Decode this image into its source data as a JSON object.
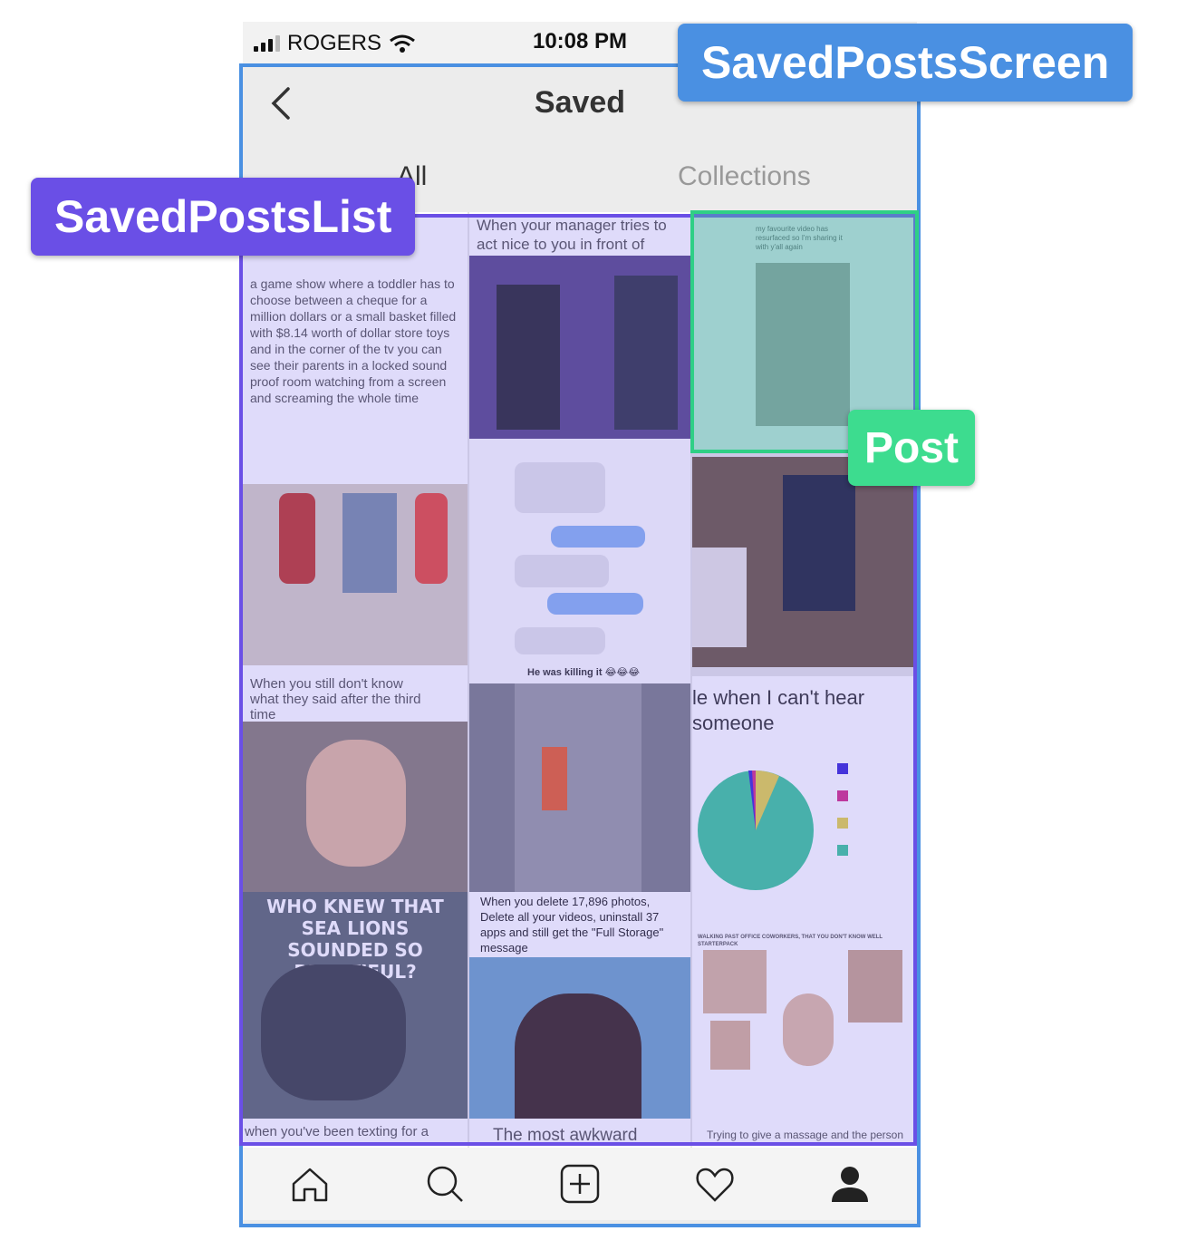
{
  "status": {
    "carrier": "ROGERS",
    "time": "10:08 PM"
  },
  "nav": {
    "title": "Saved"
  },
  "tabs": [
    {
      "label": "All"
    },
    {
      "label": "Collections"
    }
  ],
  "posts": [
    {
      "caption": "a game show where a toddler has to choose between a cheque for a million dollars or a small basket filled with $8.14 worth of dollar store toys and in the corner of the tv you can see their parents in a locked sound proof room watching from a screen and screaming the whole time"
    },
    {
      "caption": "When your manager tries to act nice to you in front of customers"
    },
    {
      "caption": "my favourite video has resurfaced so I'm sharing it with y'all again"
    },
    {
      "caption": "He was killing it 😂😂😂"
    },
    {
      "caption": "When you still don't know what they said after the third time"
    },
    {
      "caption": "le when I can't hear someone"
    },
    {
      "caption": "WHO KNEW THAT SEA LIONS SOUNDED SO BEAUTIFUL?"
    },
    {
      "caption": "When you delete 17,896 photos, Delete all your videos, uninstall 37 apps and still get the \"Full Storage\" message"
    },
    {
      "caption": "WALKING PAST OFFICE COWORKERS, THAT YOU DON'T KNOW WELL STARTERPACK"
    },
    {
      "caption": "when you've been texting for a"
    },
    {
      "caption": "The most awkward"
    },
    {
      "caption": "Trying to give a massage and the person"
    }
  ],
  "annotations": {
    "screen": "SavedPostsScreen",
    "list": "SavedPostsList",
    "post": "Post"
  },
  "colors": {
    "screen": "#4a90e2",
    "list": "#6a4fe6",
    "post": "#3ddc8f"
  }
}
